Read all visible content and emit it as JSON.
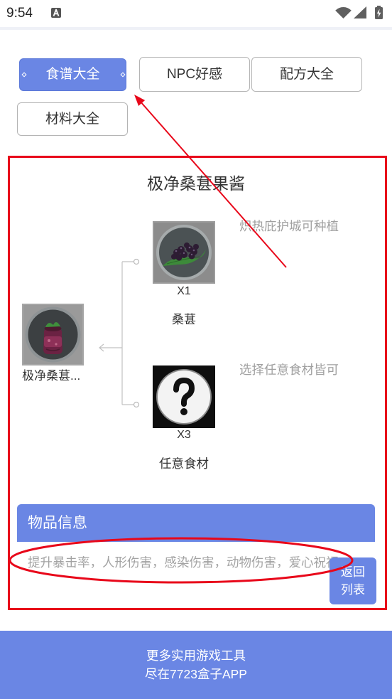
{
  "status_bar": {
    "time": "9:54",
    "notification_icon": "text-a-icon",
    "right_icons": [
      "wifi-icon",
      "signal-icon",
      "battery-charging-icon"
    ]
  },
  "tabs": [
    {
      "label": "食谱大全",
      "active": true
    },
    {
      "label": "NPC好感",
      "active": false
    },
    {
      "label": "配方大全",
      "active": false
    },
    {
      "label": "材料大全",
      "active": false
    }
  ],
  "recipe": {
    "title": "极净桑葚果酱",
    "product": {
      "name": "极净桑葚...",
      "icon": "jam-jar-icon"
    },
    "ingredients": [
      {
        "qty": "X1",
        "name": "桑葚",
        "note": "炽热庇护城可种植",
        "icon": "mulberry-icon"
      },
      {
        "qty": "X3",
        "name": "任意食材",
        "note": "选择任意食材皆可",
        "icon": "question-mark-icon"
      }
    ]
  },
  "info": {
    "header": "物品信息",
    "effects": "提升暴击率，人形伤害，感染伤害，动物伤害，爱心祝福",
    "back_button": "返回列表"
  },
  "footer": {
    "line1": "更多实用游戏工具",
    "line2": "尽在7723盒子APP"
  },
  "colors": {
    "accent": "#6a86e4",
    "annotation": "#e8071a",
    "muted_text": "#a0a0a0"
  }
}
